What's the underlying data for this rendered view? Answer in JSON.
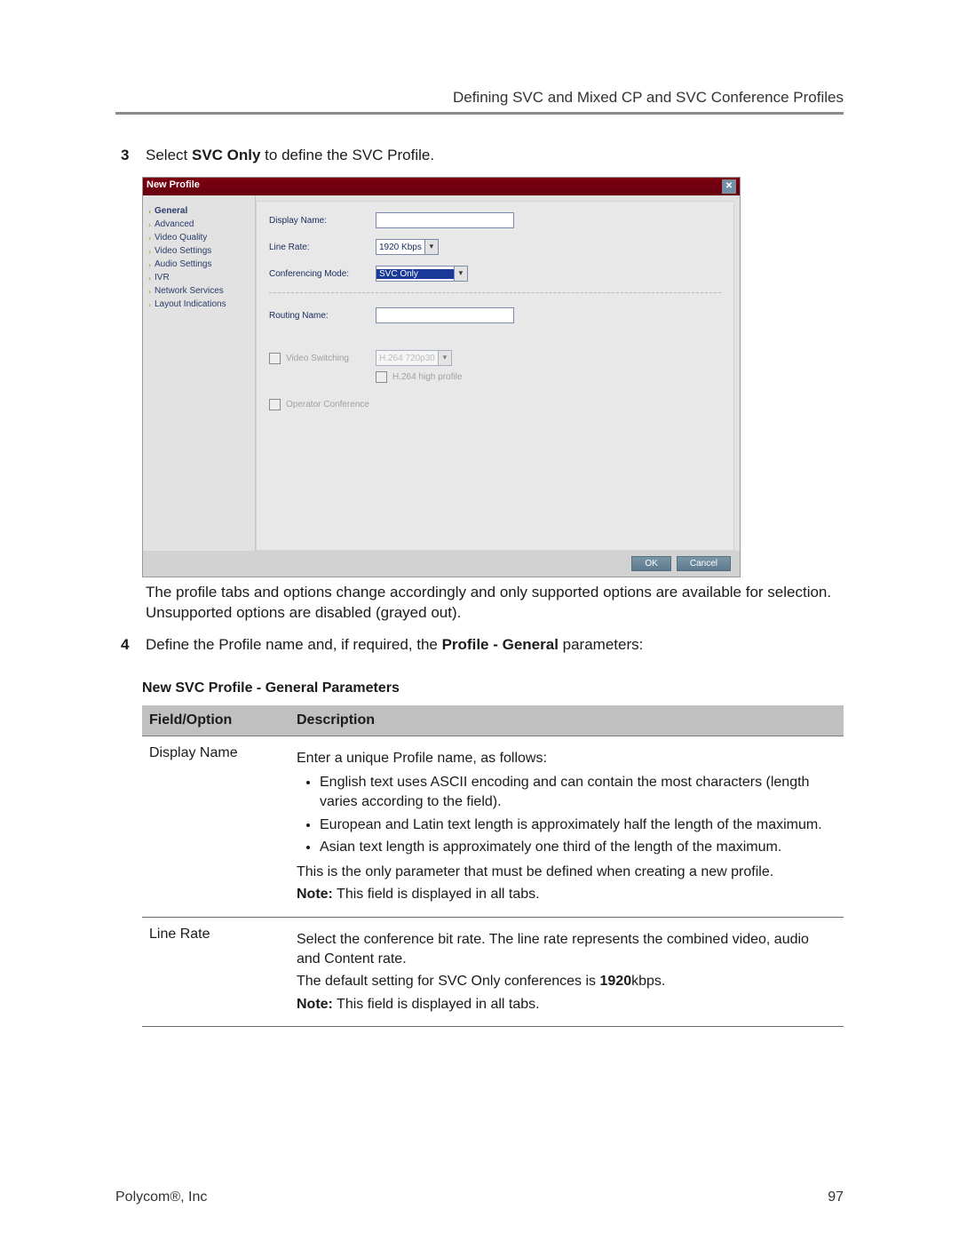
{
  "header": {
    "section_title": "Defining SVC and Mixed CP and SVC Conference Profiles"
  },
  "steps": {
    "s3": {
      "num": "3",
      "pre": "Select ",
      "bold": "SVC Only",
      "post": " to define the SVC Profile."
    },
    "caption_after": "The profile tabs and options change accordingly and only supported options are available for selection. Unsupported options are disabled (grayed out).",
    "s4": {
      "num": "4",
      "pre": "Define the Profile name and, if required, the ",
      "bold": "Profile - General",
      "post": " parameters:"
    }
  },
  "dialog": {
    "title": "New Profile",
    "close_glyph": "✕",
    "sidebar": [
      "General",
      "Advanced",
      "Video Quality",
      "Video Settings",
      "Audio Settings",
      "IVR",
      "Network Services",
      "Layout Indications"
    ],
    "labels": {
      "display_name": "Display Name:",
      "line_rate": "Line Rate:",
      "conf_mode": "Conferencing Mode:",
      "routing_name": "Routing Name:",
      "video_switching": "Video Switching",
      "h264_profile": "H.264 high profile",
      "operator_conf": "Operator Conference"
    },
    "values": {
      "line_rate": "1920 Kbps",
      "conf_mode": "SVC Only",
      "vs_select": "H.264 720p30"
    },
    "buttons": {
      "ok": "OK",
      "cancel": "Cancel"
    }
  },
  "table": {
    "title": "New SVC Profile - General Parameters",
    "head": {
      "c1": "Field/Option",
      "c2": "Description"
    },
    "row1": {
      "field": "Display Name",
      "intro": "Enter a unique Profile name, as follows:",
      "b1": "English text uses ASCII encoding and can contain the most characters (length varies according to the field).",
      "b2": "European and Latin text length is approximately half the length of the maximum.",
      "b3": "Asian text length is approximately one third of the length of the maximum.",
      "after1": "This is the only parameter that must be defined when creating a new profile.",
      "note_b": "Note:",
      "note_t": " This field is displayed in all tabs."
    },
    "row2": {
      "field": "Line Rate",
      "p1": "Select the conference bit rate. The line rate represents the combined video, audio and Content rate.",
      "p2_pre": "The default setting for SVC Only conferences is ",
      "p2_b": "1920",
      "p2_post": "kbps.",
      "note_b": "Note:",
      "note_t": " This field is displayed in all tabs."
    }
  },
  "footer": {
    "company": "Polycom®, Inc",
    "page": "97"
  }
}
